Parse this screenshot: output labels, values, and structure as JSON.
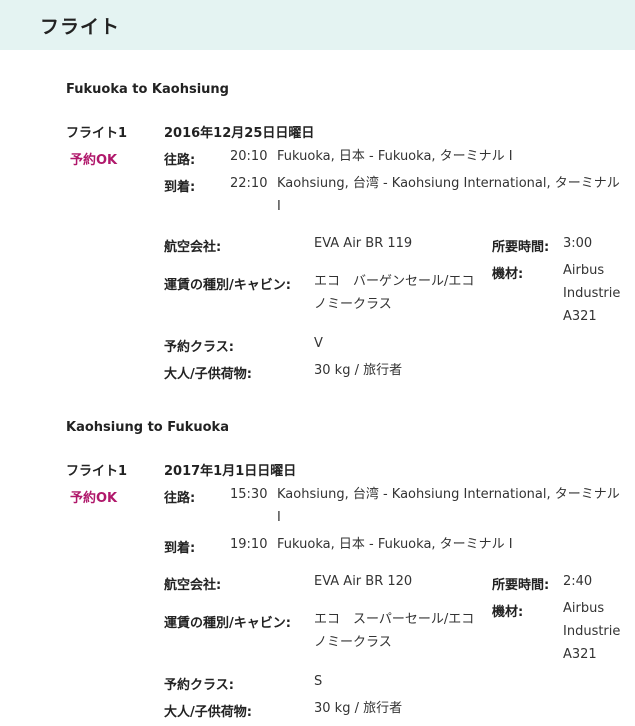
{
  "header": {
    "title": "フライト"
  },
  "itinerary": [
    {
      "route": "Fukuoka to Kaohsiung",
      "flight_label": "フライト1",
      "status": "予約OK",
      "date": "2016年12月25日日曜日",
      "departure": {
        "label": "往路:",
        "time": "20:10",
        "place": "Fukuoka, 日本 - Fukuoka, ターミナル I"
      },
      "arrival": {
        "label": "到着:",
        "time": "22:10",
        "place": "Kaohsiung, 台湾 - Kaohsiung International, ターミナル I"
      },
      "airline_label": "航空会社:",
      "airline": "EVA Air BR 119",
      "fare_label": "運賃の種別/キャビン:",
      "fare": "エコ　バーゲンセール/エコノミークラス",
      "booking_class_label": "予約クラス:",
      "booking_class": "V",
      "baggage_label": "大人/子供荷物:",
      "baggage": "30 kg / 旅行者",
      "duration_label": "所要時間:",
      "duration": "3:00",
      "aircraft_label": "機材:",
      "aircraft": "Airbus Industrie A321"
    },
    {
      "route": "Kaohsiung to Fukuoka",
      "flight_label": "フライト1",
      "status": "予約OK",
      "date": "2017年1月1日日曜日",
      "departure": {
        "label": "往路:",
        "time": "15:30",
        "place": "Kaohsiung, 台湾 - Kaohsiung International, ターミナル I"
      },
      "arrival": {
        "label": "到着:",
        "time": "19:10",
        "place": "Fukuoka, 日本 - Fukuoka, ターミナル I"
      },
      "airline_label": "航空会社:",
      "airline": "EVA Air BR 120",
      "fare_label": "運賃の種別/キャビン:",
      "fare": "エコ　スーパーセール/エコノミークラス",
      "booking_class_label": "予約クラス:",
      "booking_class": "S",
      "baggage_label": "大人/子供荷物:",
      "baggage": "30 kg / 旅行者",
      "duration_label": "所要時間:",
      "duration": "2:40",
      "aircraft_label": "機材:",
      "aircraft": "Airbus Industrie A321"
    }
  ]
}
